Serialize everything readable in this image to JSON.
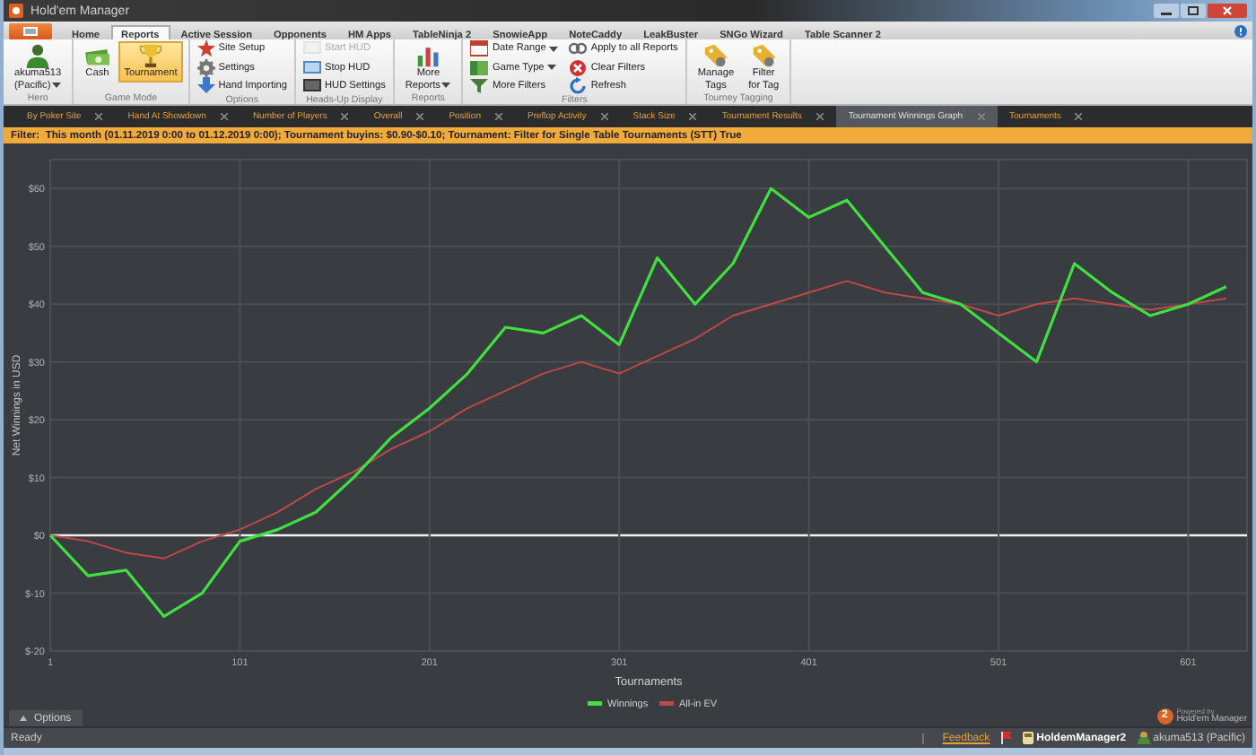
{
  "window": {
    "title": "Hold'em Manager"
  },
  "menu_tabs": [
    {
      "label": "Home",
      "selected": false
    },
    {
      "label": "Reports",
      "selected": true
    },
    {
      "label": "Active Session",
      "selected": false
    },
    {
      "label": "Opponents",
      "selected": false
    },
    {
      "label": "HM Apps",
      "selected": false
    },
    {
      "label": "TableNinja 2",
      "selected": false
    },
    {
      "label": "SnowieApp",
      "selected": false
    },
    {
      "label": "NoteCaddy",
      "selected": false
    },
    {
      "label": "LeakBuster",
      "selected": false
    },
    {
      "label": "SNGo Wizard",
      "selected": false
    },
    {
      "label": "Table Scanner 2",
      "selected": false
    }
  ],
  "ribbon": {
    "groups": [
      {
        "title": "Hero",
        "items": [
          {
            "kind": "large",
            "label": "akuma513\n(Pacific)",
            "dropdown": true
          }
        ]
      },
      {
        "title": "Game Mode",
        "items": [
          {
            "kind": "large",
            "label": "Cash",
            "selected": false
          },
          {
            "kind": "large",
            "label": "Tournament",
            "selected": true
          }
        ]
      },
      {
        "title": "Options",
        "items": [
          {
            "kind": "small",
            "label": "Site Setup"
          },
          {
            "kind": "small",
            "label": "Settings"
          },
          {
            "kind": "small",
            "label": "Hand Importing"
          }
        ]
      },
      {
        "title": "Heads-Up Display",
        "items": [
          {
            "kind": "small",
            "label": "Start HUD",
            "disabled": true
          },
          {
            "kind": "small",
            "label": "Stop HUD",
            "disabled": false
          },
          {
            "kind": "small",
            "label": "HUD Settings",
            "disabled": false
          }
        ]
      },
      {
        "title": "Reports",
        "items": [
          {
            "kind": "large",
            "label": "More\nReports",
            "dropdown": true
          }
        ]
      },
      {
        "title": "Filters",
        "items": [
          {
            "kind": "small",
            "label": "Date Range",
            "dropdown": true
          },
          {
            "kind": "small",
            "label": "Game Type",
            "dropdown": true
          },
          {
            "kind": "small",
            "label": "More Filters",
            "dropdown": false
          },
          {
            "kind": "small",
            "label": "Apply to all Reports",
            "dropdown": false
          },
          {
            "kind": "small",
            "label": "Clear Filters",
            "dropdown": false
          },
          {
            "kind": "small",
            "label": "Refresh",
            "dropdown": false
          }
        ]
      },
      {
        "title": "Tourney Tagging",
        "items": [
          {
            "kind": "large",
            "label": "Manage\nTags"
          },
          {
            "kind": "large",
            "label": "Filter\nfor Tag"
          }
        ]
      }
    ]
  },
  "report_tabs": [
    {
      "label": "By Poker Site",
      "selected": false
    },
    {
      "label": "Hand At Showdown",
      "selected": false
    },
    {
      "label": "Number of Players",
      "selected": false
    },
    {
      "label": "Overall",
      "selected": false
    },
    {
      "label": "Position",
      "selected": false
    },
    {
      "label": "Preflop Activity",
      "selected": false
    },
    {
      "label": "Stack Size",
      "selected": false
    },
    {
      "label": "Tournament Results",
      "selected": false
    },
    {
      "label": "Tournament Winnings Graph",
      "selected": true
    },
    {
      "label": "Tournaments",
      "selected": false
    }
  ],
  "filter_bar": {
    "text": "Filter:  This month (01.11.2019 0:00 to 01.12.2019 0:00); Tournament buyins: $0.90-$0.10; Tournament: Filter for Single Table Tournaments (STT) True"
  },
  "graph": {
    "chart_data": {
      "type": "line",
      "xlabel": "Tournaments",
      "ylabel": "Net Winnings in USD",
      "x": [
        1,
        21,
        41,
        61,
        81,
        101,
        121,
        141,
        161,
        181,
        201,
        221,
        241,
        261,
        281,
        301,
        321,
        341,
        361,
        381,
        401,
        421,
        441,
        461,
        481,
        501,
        521,
        541,
        561,
        581,
        601,
        621
      ],
      "series": [
        {
          "name": "Winnings",
          "color": "#40e040",
          "values": [
            0,
            -7,
            -6,
            -14,
            -10,
            -1,
            1,
            4,
            10,
            17,
            22,
            28,
            36,
            35,
            38,
            33,
            48,
            40,
            47,
            60,
            55,
            58,
            50,
            42,
            40,
            35,
            30,
            47,
            42,
            38,
            40,
            43
          ]
        },
        {
          "name": "All-in EV",
          "color": "#c04848",
          "values": [
            0,
            -1,
            -3,
            -4,
            -1,
            1,
            4,
            8,
            11,
            15,
            18,
            22,
            25,
            28,
            30,
            28,
            31,
            34,
            38,
            40,
            42,
            44,
            42,
            41,
            40,
            38,
            40,
            41,
            40,
            39,
            40,
            41
          ]
        }
      ],
      "xlim": [
        1,
        632
      ],
      "ylim": [
        -20,
        65
      ],
      "grid": true,
      "legend": true,
      "xticks": [
        1,
        101,
        201,
        301,
        401,
        501,
        601
      ],
      "yticks": [
        {
          "value": -20,
          "label": "$-20"
        },
        {
          "value": -10,
          "label": "$-10"
        },
        {
          "value": 0,
          "label": "$0"
        },
        {
          "value": 10,
          "label": "$10"
        },
        {
          "value": 20,
          "label": "$20"
        },
        {
          "value": 30,
          "label": "$30"
        },
        {
          "value": 40,
          "label": "$40"
        },
        {
          "value": 50,
          "label": "$50"
        },
        {
          "value": 60,
          "label": "$60"
        }
      ]
    }
  },
  "options_bar": {
    "label": "Options",
    "logo": {
      "badge": "2",
      "line1": "Powered by",
      "line2": "Hold'em Manager"
    }
  },
  "status_bar": {
    "status": "Ready",
    "feedback": "Feedback",
    "database": "HoldemManager2",
    "hero": "akuma513 (Pacific)"
  }
}
